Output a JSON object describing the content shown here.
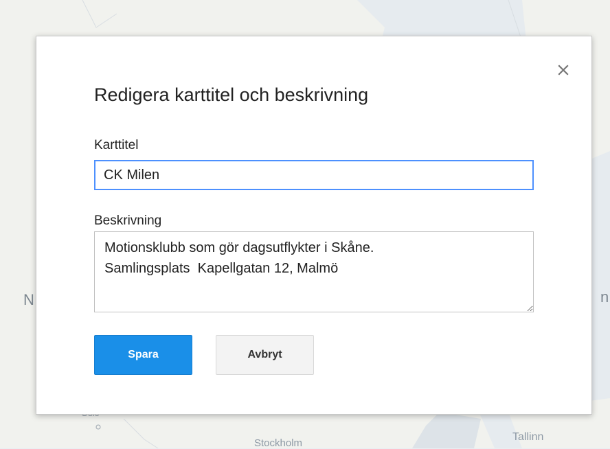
{
  "map": {
    "labels": {
      "oslo": "Oslo",
      "stockholm": "Stockholm",
      "tallinn": "Tallinn",
      "left_edge": "N",
      "right_edge": "n"
    }
  },
  "dialog": {
    "title": "Redigera karttitel och beskrivning",
    "close_icon": "close-icon",
    "title_field": {
      "label": "Karttitel",
      "value": "CK Milen"
    },
    "description_field": {
      "label": "Beskrivning",
      "value": "Motionsklubb som gör dagsutflykter i Skåne.\nSamlingsplats  Kapellgatan 12, Malmö"
    },
    "buttons": {
      "save": "Spara",
      "cancel": "Avbryt"
    },
    "colors": {
      "primary": "#1a8fe8",
      "focus_border": "#4d90fe"
    }
  }
}
